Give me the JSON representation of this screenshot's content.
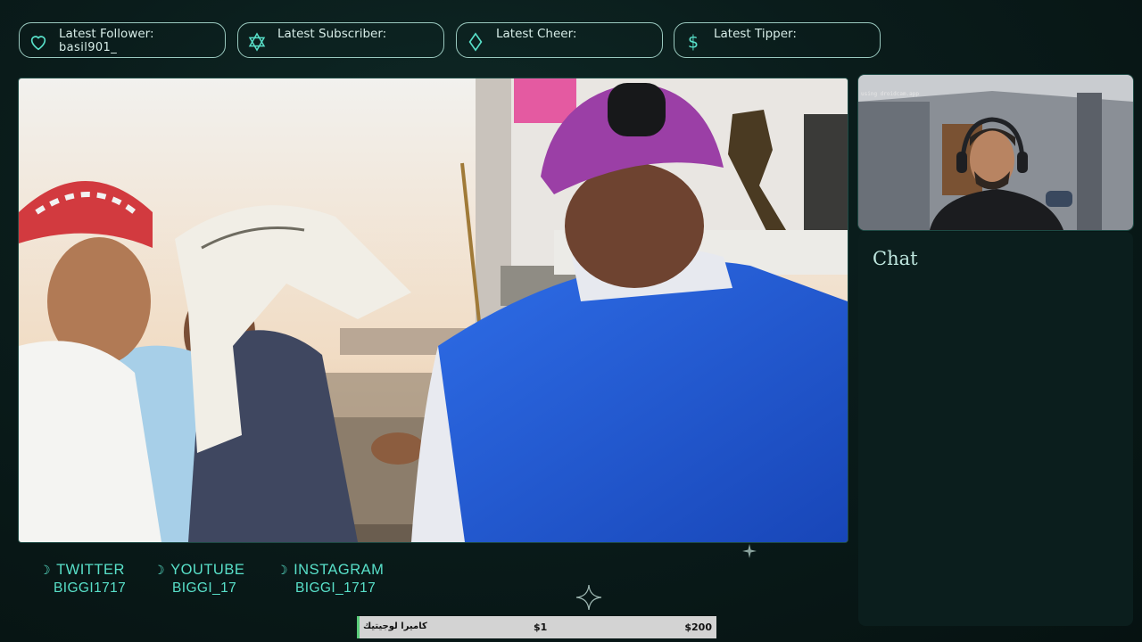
{
  "alerts": [
    {
      "icon": "heart-icon",
      "label": "Latest Follower:",
      "value": "basil901_"
    },
    {
      "icon": "star-of-david-icon",
      "label": "Latest Subscriber:",
      "value": ""
    },
    {
      "icon": "diamond-icon",
      "label": "Latest Cheer:",
      "value": ""
    },
    {
      "icon": "dollar-icon",
      "label": "Latest Tipper:",
      "value": ""
    }
  ],
  "webcam": {
    "caption": "using droidcam.app"
  },
  "chat": {
    "title": "Chat"
  },
  "socials": [
    {
      "platform": "TWITTER",
      "handle": "BIGGI1717"
    },
    {
      "platform": "YOUTUBE",
      "handle": "BIGGI_17"
    },
    {
      "platform": "INSTAGRAM",
      "handle": "BIGGI_1717"
    }
  ],
  "goal": {
    "title": "كاميرا لوجيتيك",
    "current": "$1",
    "target": "$200"
  },
  "colors": {
    "accent": "#58e0c9",
    "pill_border": "#9ac9bf",
    "background": "#0a1c1b",
    "goal_bar": "#d3d3d3"
  }
}
